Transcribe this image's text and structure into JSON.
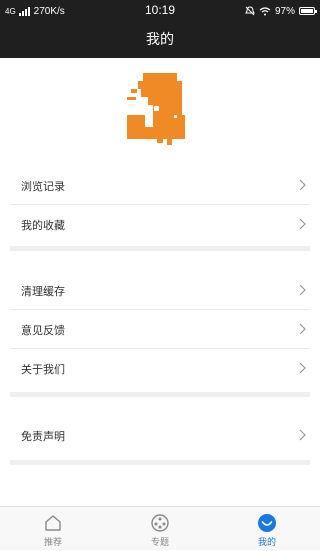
{
  "status_bar": {
    "network": "4G",
    "speed": "270K/s",
    "time": "10:19",
    "battery": "97%",
    "battery_level": 0.97
  },
  "header": {
    "title": "我的"
  },
  "logo": {
    "icon": "j-logo-icon",
    "color": "#f08a24"
  },
  "menu_groups": [
    {
      "items": [
        {
          "label": "浏览记录"
        },
        {
          "label": "我的收藏"
        }
      ]
    },
    {
      "items": [
        {
          "label": "清理缓存"
        },
        {
          "label": "意见反馈"
        },
        {
          "label": "关于我们"
        }
      ]
    },
    {
      "items": [
        {
          "label": "免责声明"
        }
      ]
    }
  ],
  "tabs": [
    {
      "label": "推荐",
      "icon": "home-icon",
      "active": false
    },
    {
      "label": "专题",
      "icon": "topic-icon",
      "active": false
    },
    {
      "label": "我的",
      "icon": "profile-smile-icon",
      "active": true
    }
  ],
  "colors": {
    "accent": "#1a78e6",
    "header_bg": "#1f1f1f"
  }
}
